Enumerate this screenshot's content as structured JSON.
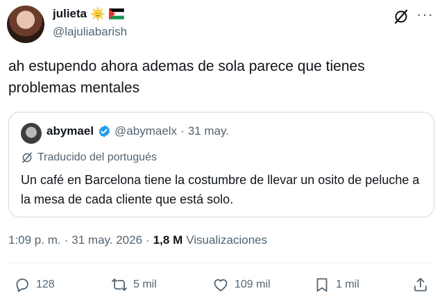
{
  "author": {
    "name": "julieta",
    "handle": "@lajuliabarish",
    "emojis": [
      "sun-with-face-icon",
      "palestine-flag-icon"
    ]
  },
  "tweet": {
    "text": "ah estupendo ahora ademas de sola parece que tienes problemas mentales"
  },
  "quote": {
    "name": "abymael",
    "handle": "@abymaelx",
    "separator": "·",
    "date": "31 may.",
    "translated_label": "Traducido del portugués",
    "text": "Un café en Barcelona tiene la costumbre de llevar un osito de peluche a la mesa de cada cliente que está solo."
  },
  "meta": {
    "time": "1:09 p. m.",
    "sep1": "·",
    "date": "31 may. 2026",
    "sep2": "·",
    "views_count": "1,8 M",
    "views_label": "Visualizaciones"
  },
  "actions": {
    "replies": "128",
    "reposts": "5 mil",
    "likes": "109 mil",
    "bookmarks": "1 mil"
  },
  "colors": {
    "text": "#0f1419",
    "muted": "#536471",
    "border": "#cfd9de",
    "verified": "#1d9bf0"
  }
}
